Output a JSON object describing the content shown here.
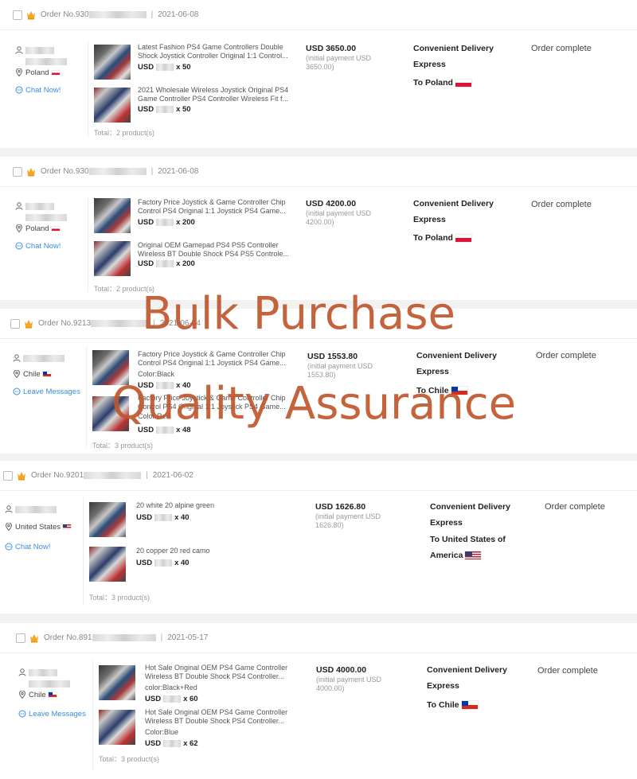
{
  "orders": [
    {
      "order_no": "Order No.930",
      "date": "2021-06-08",
      "country": "Poland",
      "contact": "Chat Now!",
      "products": [
        {
          "name": "Latest Fashion PS4 Game Controllers Double Shock Joystick Controller Original 1:1 Control...",
          "variant": "",
          "currency": "USD",
          "qty": "x 50"
        },
        {
          "name": "2021 Wholesale Wireless Joystick Original PS4 Game Controller PS4 Controller Wireless Fit f...",
          "variant": "",
          "currency": "USD",
          "qty": "x 50"
        }
      ],
      "total": "Total：2 product(s)",
      "price": "USD 3650.00",
      "initial_payment": "(initial payment USD 3650.00)",
      "shipping": "Convenient Delivery Express",
      "destination": "To Poland",
      "status": "Order complete"
    },
    {
      "order_no": "Order No.930",
      "date": "2021-06-08",
      "country": "Poland",
      "contact": "Chat Now!",
      "products": [
        {
          "name": "Factory Price Joystick & Game Controller Chip Control PS4 Original 1:1 Joystick PS4 Game...",
          "variant": "",
          "currency": "USD",
          "qty": "x 200"
        },
        {
          "name": "Original OEM Gamepad PS4 PS5 Controller Wireless BT Double Shock PS4 PS5 Controle...",
          "variant": "",
          "currency": "USD",
          "qty": "x 200"
        }
      ],
      "total": "Total：2 product(s)",
      "price": "USD 4200.00",
      "initial_payment": "(initial payment USD 4200.00)",
      "shipping": "Convenient Delivery Express",
      "destination": "To Poland",
      "status": "Order complete"
    },
    {
      "order_no": "Order No.9213",
      "date": "2021-06-04",
      "country": "Chile",
      "contact": "Leave Messages",
      "products": [
        {
          "name": "Factory Price Joystick & Game Controller Chip Control PS4 Original 1:1 Joystick PS4 Game...",
          "variant": "Color:Black",
          "currency": "USD",
          "qty": "x 40"
        },
        {
          "name": "Factory Price Joystick & Game Controller Chip Control PS4 Original 1:1 Joystick PS4 Game...",
          "variant": "Color:Red",
          "currency": "USD",
          "qty": "x 48"
        }
      ],
      "total": "Total：3 product(s)",
      "price": "USD 1553.80",
      "initial_payment": "(initial payment USD 1553.80)",
      "shipping": "Convenient Delivery Express",
      "destination": "To Chile",
      "status": "Order complete"
    },
    {
      "order_no": "Order No.9201",
      "date": "2021-06-02",
      "country": "United States",
      "contact": "Chat Now!",
      "products": [
        {
          "name": "20 white 20 alpine green",
          "variant": "",
          "currency": "USD",
          "qty": "x 40"
        },
        {
          "name": "20 copper 20 red camo",
          "variant": "",
          "currency": "USD",
          "qty": "x 40"
        }
      ],
      "total": "Total：3 product(s)",
      "price": "USD 1626.80",
      "initial_payment": "(initial payment USD 1626.80)",
      "shipping": "Convenient Delivery Express",
      "destination": "To United States of America",
      "status": "Order complete"
    },
    {
      "order_no": "Order No.891",
      "date": "2021-05-17",
      "country": "Chile",
      "contact": "Leave Messages",
      "products": [
        {
          "name": "Hot Sale Original OEM PS4 Game Controller Wireless BT Double Shock PS4 Controller...",
          "variant": "color:Black+Red",
          "currency": "USD",
          "qty": "x 60"
        },
        {
          "name": "Hot Sale Original OEM PS4 Game Controller Wireless BT Double Shock PS4 Controller...",
          "variant": "Color:Blue",
          "currency": "USD",
          "qty": "x 62"
        }
      ],
      "total": "Total：3 product(s)",
      "price": "USD 4000.00",
      "initial_payment": "(initial payment USD 4000.00)",
      "shipping": "Convenient Delivery Express",
      "destination": "To Chile",
      "status": "Order complete"
    }
  ],
  "watermark": {
    "line1": "Bulk Purchase",
    "line2": "Quality Assurance",
    "color": "#c0562c"
  },
  "colors": {
    "link": "#3a8ee6",
    "crown": "#f5a623"
  },
  "icons": {
    "user": "user-icon",
    "location": "location-pin-icon",
    "chat": "chat-icon",
    "crown": "crown-icon"
  }
}
